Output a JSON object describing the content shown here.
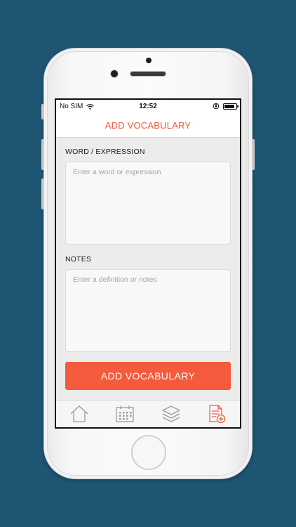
{
  "status_bar": {
    "carrier": "No SIM",
    "time": "12:52",
    "battery_level": 0.9
  },
  "nav": {
    "title": "ADD VOCABULARY"
  },
  "form": {
    "word_label": "WORD / EXPRESSION",
    "word_placeholder": "Enter a word or expression",
    "word_value": "",
    "notes_label": "NOTES",
    "notes_placeholder": "Enter a definition or notes",
    "notes_value": "",
    "submit_label": "ADD VOCABULARY"
  },
  "tabs": [
    {
      "icon": "home-icon",
      "active": false
    },
    {
      "icon": "calendar-icon",
      "active": false
    },
    {
      "icon": "layers-icon",
      "active": false
    },
    {
      "icon": "add-note-icon",
      "active": true
    }
  ],
  "colors": {
    "accent": "#f45a3c",
    "background": "#1e5573",
    "inactive_icon": "#9a9a9a"
  }
}
